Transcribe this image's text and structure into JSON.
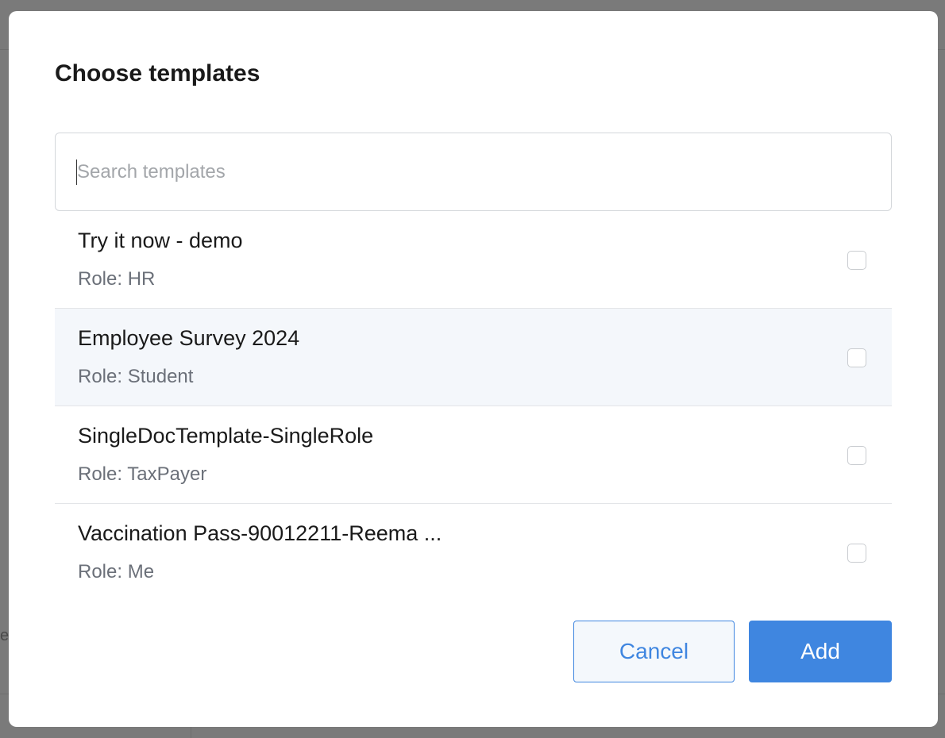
{
  "modal": {
    "title": "Choose templates"
  },
  "search": {
    "placeholder": "Search templates",
    "value": ""
  },
  "templates": [
    {
      "name": "Try it now - demo",
      "role": "Role: HR",
      "checked": false
    },
    {
      "name": "Employee Survey 2024",
      "role": "Role: Student",
      "checked": false
    },
    {
      "name": "SingleDocTemplate-SingleRole",
      "role": "Role: TaxPayer",
      "checked": false
    },
    {
      "name": "Vaccination Pass-90012211-Reema ...",
      "role": "Role: Me",
      "checked": false
    }
  ],
  "actions": {
    "cancel_label": "Cancel",
    "add_label": "Add"
  },
  "background": {
    "fragment_text": "ea"
  },
  "colors": {
    "accent": "#3f86e0",
    "overlay": "#7a7a7a",
    "row_highlight": "#f4f7fb"
  }
}
